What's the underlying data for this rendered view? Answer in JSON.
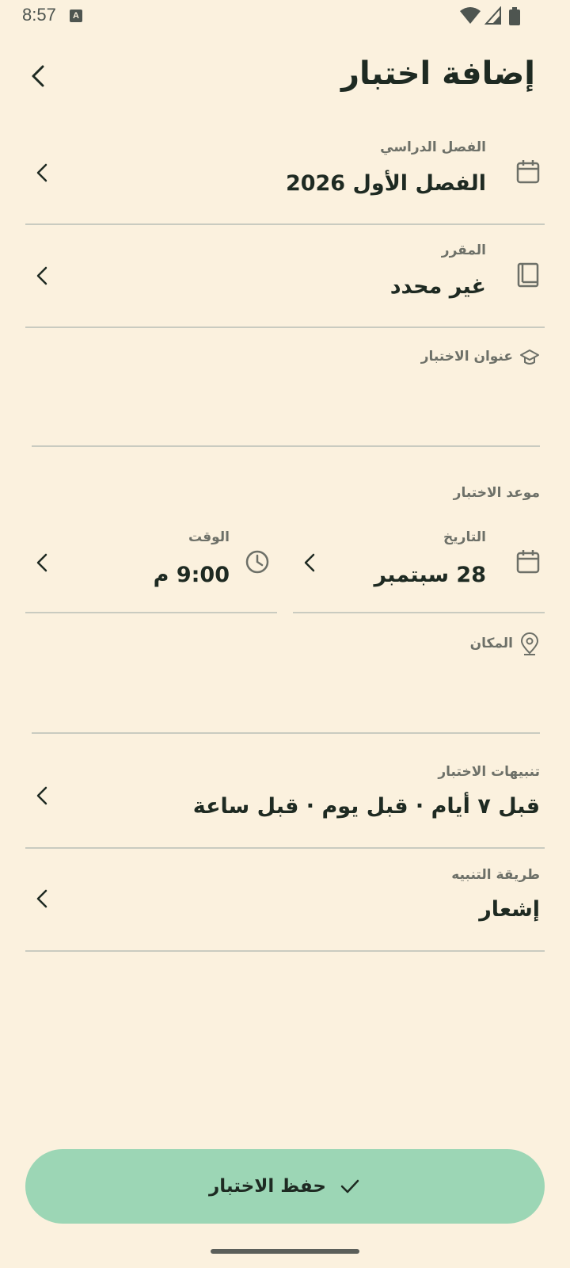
{
  "status": {
    "time": "8:57",
    "badge": "A"
  },
  "header": {
    "title": "إضافة اختبار"
  },
  "semester": {
    "label": "الفصل الدراسي",
    "value": "الفصل الأول 2026"
  },
  "course": {
    "label": "المقرر",
    "value": "غير محدد"
  },
  "exam_title": {
    "label": "عنوان الاختبار",
    "value": ""
  },
  "schedule": {
    "section_label": "موعد الاختبار",
    "date_label": "التاريخ",
    "date_value": "28 سبتمبر",
    "time_label": "الوقت",
    "time_value": "9:00 م"
  },
  "location": {
    "label": "المكان",
    "value": ""
  },
  "alerts": {
    "label": "تنبيهات الاختبار",
    "value": "قبل ٧ أيام · قبل يوم · قبل ساعة"
  },
  "alert_method": {
    "label": "طريقة التنبيه",
    "value": "إشعار"
  },
  "save_button": {
    "label": "حفظ الاختبار"
  },
  "colors": {
    "background": "#FBF1DE",
    "accent": "#9CD6B5",
    "text": "#1E2A22",
    "muted": "#6D7068"
  }
}
